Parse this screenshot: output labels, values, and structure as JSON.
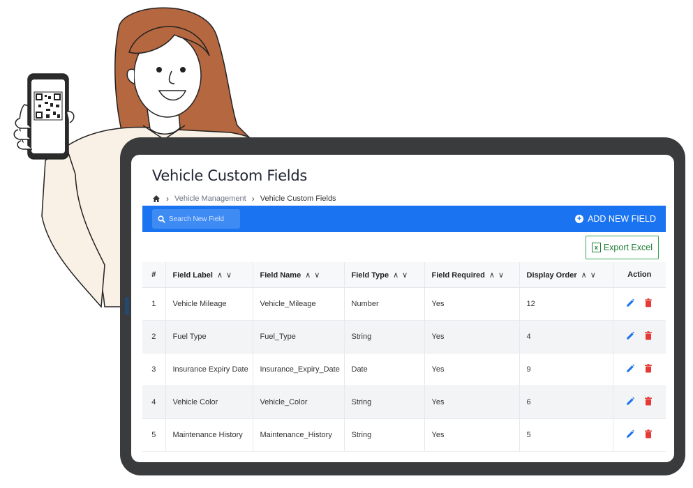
{
  "page": {
    "title": "Vehicle Custom Fields"
  },
  "breadcrumb": {
    "home_icon": "home-icon",
    "items": [
      "Vehicle Management",
      "Vehicle Custom Fields"
    ]
  },
  "toolbar": {
    "search_placeholder": "Search New Field",
    "search_icon": "search-icon",
    "add_label": "ADD NEW FIELD",
    "export_label": "Export Excel"
  },
  "table": {
    "columns": [
      "#",
      "Field Label",
      "Field Name",
      "Field Type",
      "Field Required",
      "Display Order",
      "Action"
    ],
    "rows": [
      {
        "num": "1",
        "label": "Vehicle Mileage",
        "name": "Vehicle_Mileage",
        "type": "Number",
        "required": "Yes",
        "order": "12"
      },
      {
        "num": "2",
        "label": "Fuel Type",
        "name": "Fuel_Type",
        "type": "String",
        "required": "Yes",
        "order": "4"
      },
      {
        "num": "3",
        "label": "Insurance Expiry Date",
        "name": "Insurance_Expiry_Date",
        "type": "Date",
        "required": "Yes",
        "order": "9"
      },
      {
        "num": "4",
        "label": "Vehicle Color",
        "name": "Vehicle_Color",
        "type": "String",
        "required": "Yes",
        "order": "6"
      },
      {
        "num": "5",
        "label": "Maintenance History",
        "name": "Maintenance_History",
        "type": "String",
        "required": "Yes",
        "order": "5"
      }
    ]
  },
  "colors": {
    "toolbar": "#1a73f0",
    "export": "#3aa657",
    "edit": "#1a73f0",
    "delete": "#e53935",
    "tablet_frame": "#3a3b3d",
    "hair": "#b5673f"
  }
}
